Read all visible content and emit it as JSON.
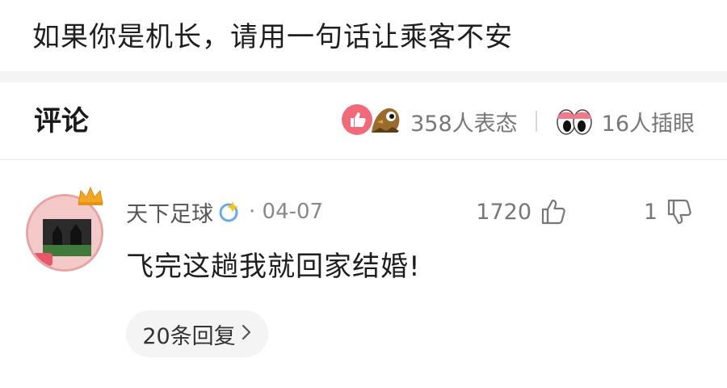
{
  "post": {
    "title": "如果你是机长，请用一句话让乘客不安"
  },
  "comments_header": {
    "title": "评论",
    "reactions_primary": "358人表态",
    "reactions_secondary": "16人插眼"
  },
  "comment": {
    "username": "天下足球",
    "date": "· 04-07",
    "like_count": "1720",
    "dislike_count": "1",
    "body": "飞完这趟我就回家结婚!",
    "reply_label": "20条回复"
  },
  "colors": {
    "like_badge": "#f06a7a",
    "eye_pink": "#f07a8a",
    "crown": "#f5a623",
    "avatar_ring": "#e8a3a3"
  },
  "icons": {
    "like_badge": "thumbs-up-badge-icon",
    "bird": "bird-emoji-icon",
    "eyes": "eyes-icon",
    "verified": "sparkle-badge-icon",
    "thumbs_up": "thumbs-up-icon",
    "thumbs_down": "thumbs-down-icon",
    "chevron": "chevron-right-icon",
    "crown": "crown-icon"
  }
}
